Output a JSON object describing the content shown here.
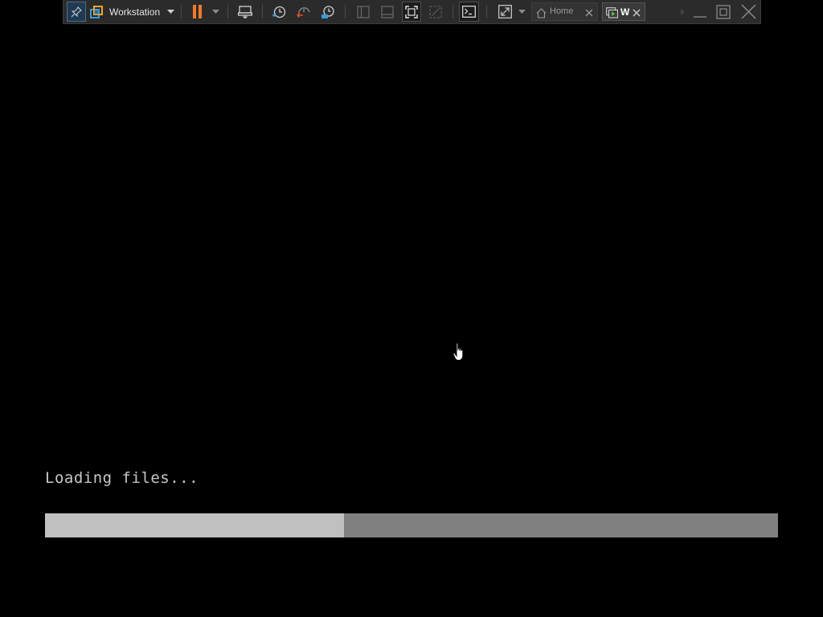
{
  "toolbar": {
    "vm_selector_label": "Workstation",
    "tabs": [
      {
        "label": "Home"
      },
      {
        "label": "W"
      }
    ],
    "icons": {
      "pin": "pin-icon",
      "vmware_logo": "workstation-logo-icon",
      "dropdown": "chevron-down-icon",
      "pause": "pause-icon",
      "send_ctrl_alt_del": "send-keys-icon",
      "snapshot": "snapshot-icon",
      "revert_snapshot": "revert-snapshot-icon",
      "snapshot_manager": "snapshot-manager-icon",
      "console_view": "console-view-icon",
      "fullscreen": "fullscreen-icon"
    },
    "colors": {
      "background": "#2b2b2b",
      "pause_accent": "#f07a2c",
      "logo_blue": "#3a9ad9",
      "logo_orange": "#f5a623"
    }
  },
  "console": {
    "status_text": "Loading files...",
    "progress_fraction": 0.408,
    "colors": {
      "background": "#000000",
      "text": "#c8c8c8",
      "progress_fill": "#c0c0c0",
      "progress_track": "#808080"
    }
  }
}
